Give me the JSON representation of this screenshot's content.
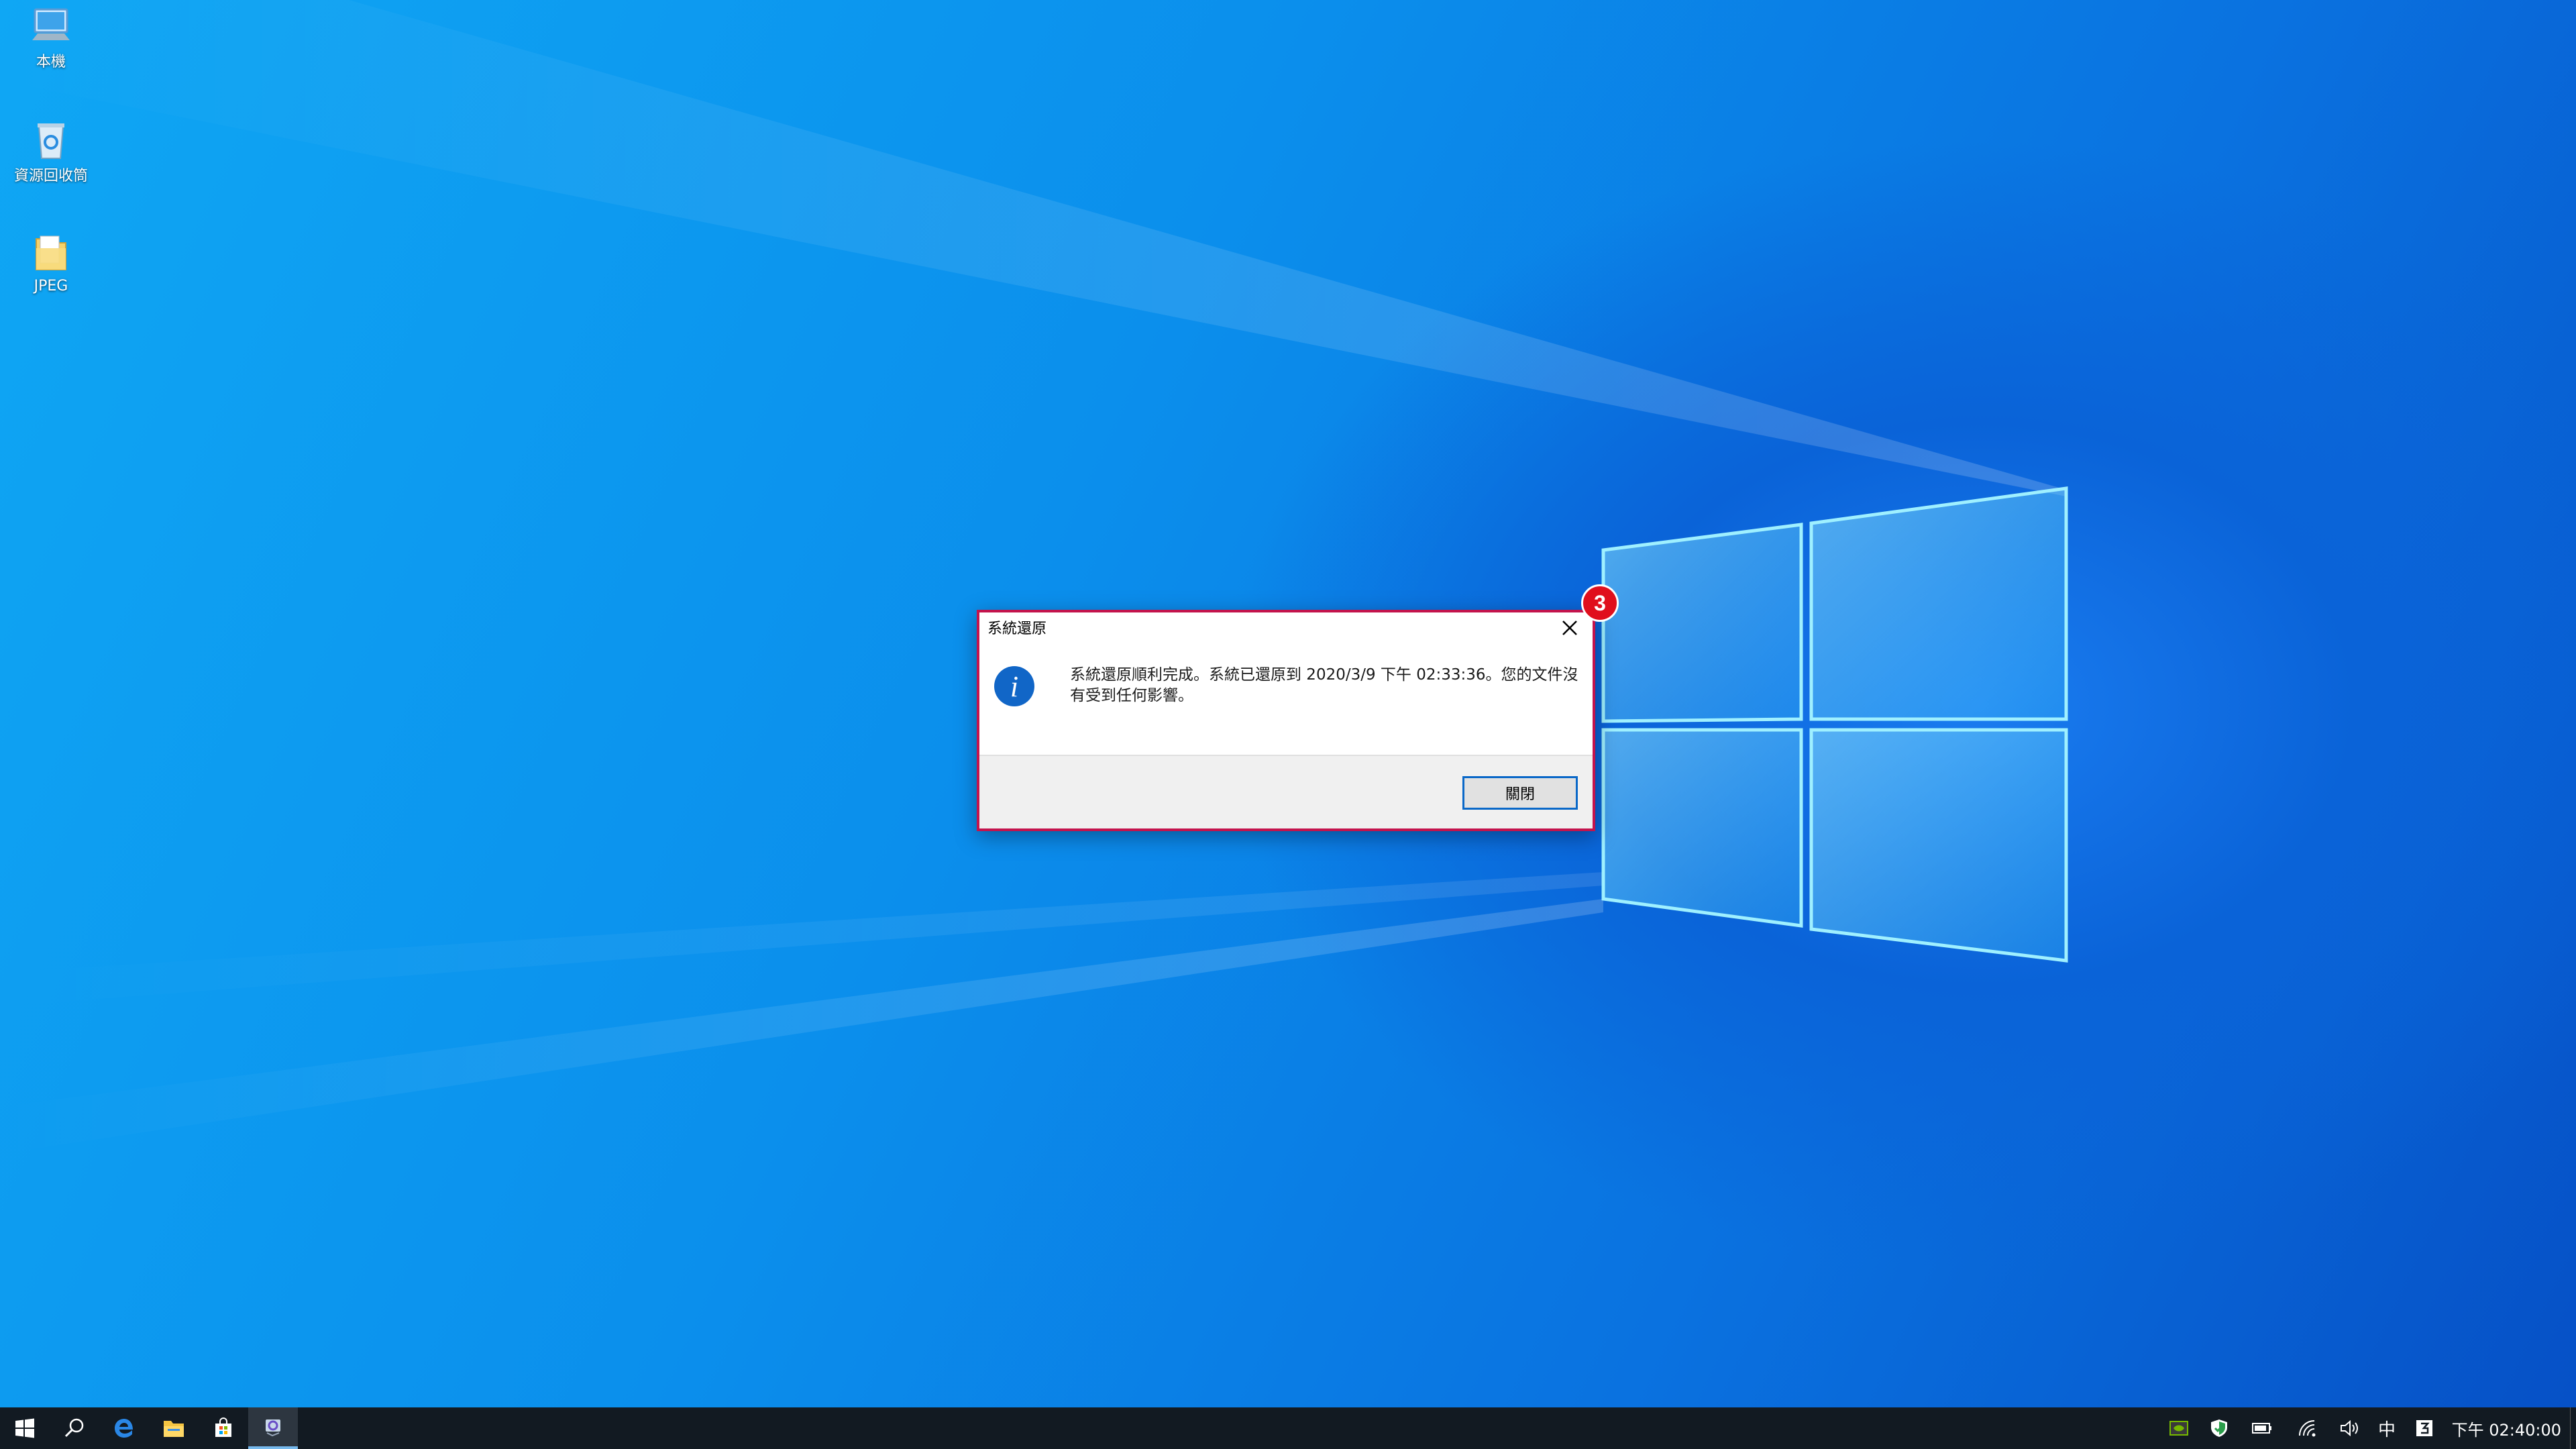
{
  "desktop": {
    "icons": [
      {
        "label": "本機",
        "icon": "computer-icon"
      },
      {
        "label": "資源回收筒",
        "icon": "recycle-bin-icon"
      },
      {
        "label": "JPEG",
        "icon": "folder-icon"
      }
    ]
  },
  "dialog": {
    "title": "系統還原",
    "message": "系統還原順利完成。系統已還原到 2020/3/9 下午 02:33:36。您的文件沒有受到任何影響。",
    "close_button_label": "關閉",
    "info_icon": "information-icon",
    "badge_number": "3",
    "highlight_color": "#c3144d",
    "badge_color": "#e00f1c"
  },
  "taskbar": {
    "buttons": [
      {
        "name": "start",
        "icon": "windows-start-icon"
      },
      {
        "name": "search",
        "icon": "search-icon"
      },
      {
        "name": "edge",
        "icon": "edge-icon"
      },
      {
        "name": "file-explorer",
        "icon": "folder-icon"
      },
      {
        "name": "store",
        "icon": "store-icon"
      },
      {
        "name": "system-restore",
        "icon": "system-restore-icon",
        "active": true
      }
    ],
    "tray": {
      "ime_label": "中",
      "clock": "下午 02:40:00"
    }
  },
  "colors": {
    "taskbar_bg": "#121a22",
    "accent": "#0a68c8"
  }
}
